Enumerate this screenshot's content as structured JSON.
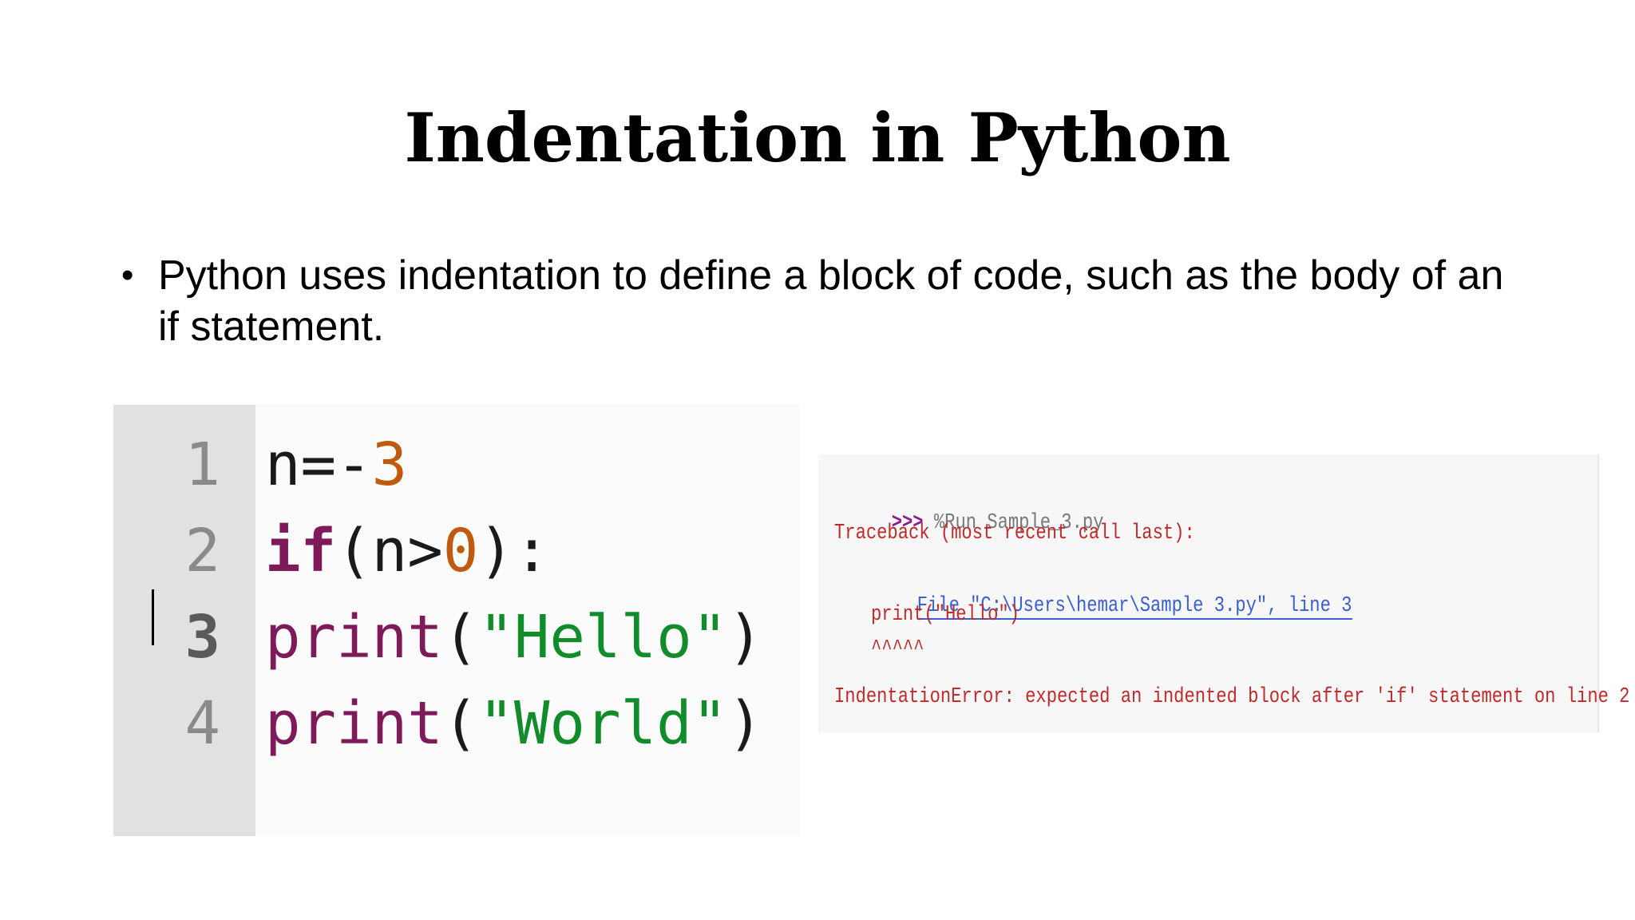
{
  "slide": {
    "title": "Indentation in Python",
    "bullets": [
      {
        "text": "Python uses indentation to define a block of code, such as the body of an if statement."
      }
    ]
  },
  "editor": {
    "line_numbers": [
      "1",
      "2",
      "3",
      "4"
    ],
    "lines": [
      [
        {
          "t": "n=-",
          "c": "plain"
        },
        {
          "t": "3",
          "c": "num"
        }
      ],
      [
        {
          "t": "if",
          "c": "kw"
        },
        {
          "t": "(n>",
          "c": "plain"
        },
        {
          "t": "0",
          "c": "num"
        },
        {
          "t": "):",
          "c": "plain"
        }
      ],
      [
        {
          "t": "print",
          "c": "fn"
        },
        {
          "t": "(",
          "c": "plain"
        },
        {
          "t": "\"Hello\"",
          "c": "str"
        },
        {
          "t": ")",
          "c": "plain"
        }
      ],
      [
        {
          "t": "print",
          "c": "fn"
        },
        {
          "t": "(",
          "c": "plain"
        },
        {
          "t": "\"World\"",
          "c": "str"
        },
        {
          "t": ")",
          "c": "plain"
        }
      ]
    ],
    "current_line": 3
  },
  "console": {
    "prompt": ">>>",
    "command": "%Run Sample_3.py",
    "traceback_header": "Traceback (most recent call last):",
    "file_link": "File \"C:\\Users\\hemar\\Sample 3.py\", line 3",
    "source_line": "print(\"Hello\")",
    "caret_marks": "^^^^^",
    "error_message": "IndentationError: expected an indented block after 'if' statement on line 2"
  },
  "colors": {
    "keyword": "#7f1a5a",
    "number": "#c05a0e",
    "string": "#118c2a",
    "error": "#c02a2a",
    "link": "#3a5fd0",
    "gutter": "#e1e1e1"
  }
}
